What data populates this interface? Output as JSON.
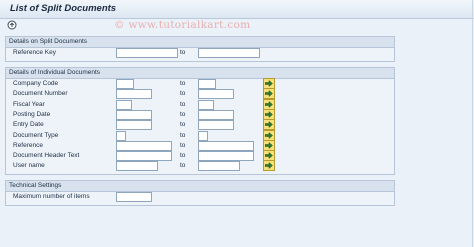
{
  "window": {
    "title": "List of Split Documents"
  },
  "watermark": "© www.tutorialkart.com",
  "toolbar": {
    "execute_icon": "execute-icon"
  },
  "split_group": {
    "title": "Details on Split Documents",
    "reference_key": {
      "label": "Reference Key",
      "from": "",
      "to_label": "to",
      "to": ""
    }
  },
  "individual_group": {
    "title": "Details of Individual Documents",
    "rows": [
      {
        "label": "Company Code",
        "to_label": "to"
      },
      {
        "label": "Document Number",
        "to_label": "to"
      },
      {
        "label": "Fiscal Year",
        "to_label": "to"
      },
      {
        "label": "Posting Date",
        "to_label": "to"
      },
      {
        "label": "Entry Date",
        "to_label": "to"
      },
      {
        "label": "Document Type",
        "to_label": "to"
      },
      {
        "label": "Reference",
        "to_label": "to"
      },
      {
        "label": "Document Header Text",
        "to_label": "to"
      },
      {
        "label": "User name",
        "to_label": "to"
      }
    ]
  },
  "technical_group": {
    "title": "Technical Settings",
    "max_items": {
      "label": "Maximum number of items",
      "value": ""
    }
  }
}
